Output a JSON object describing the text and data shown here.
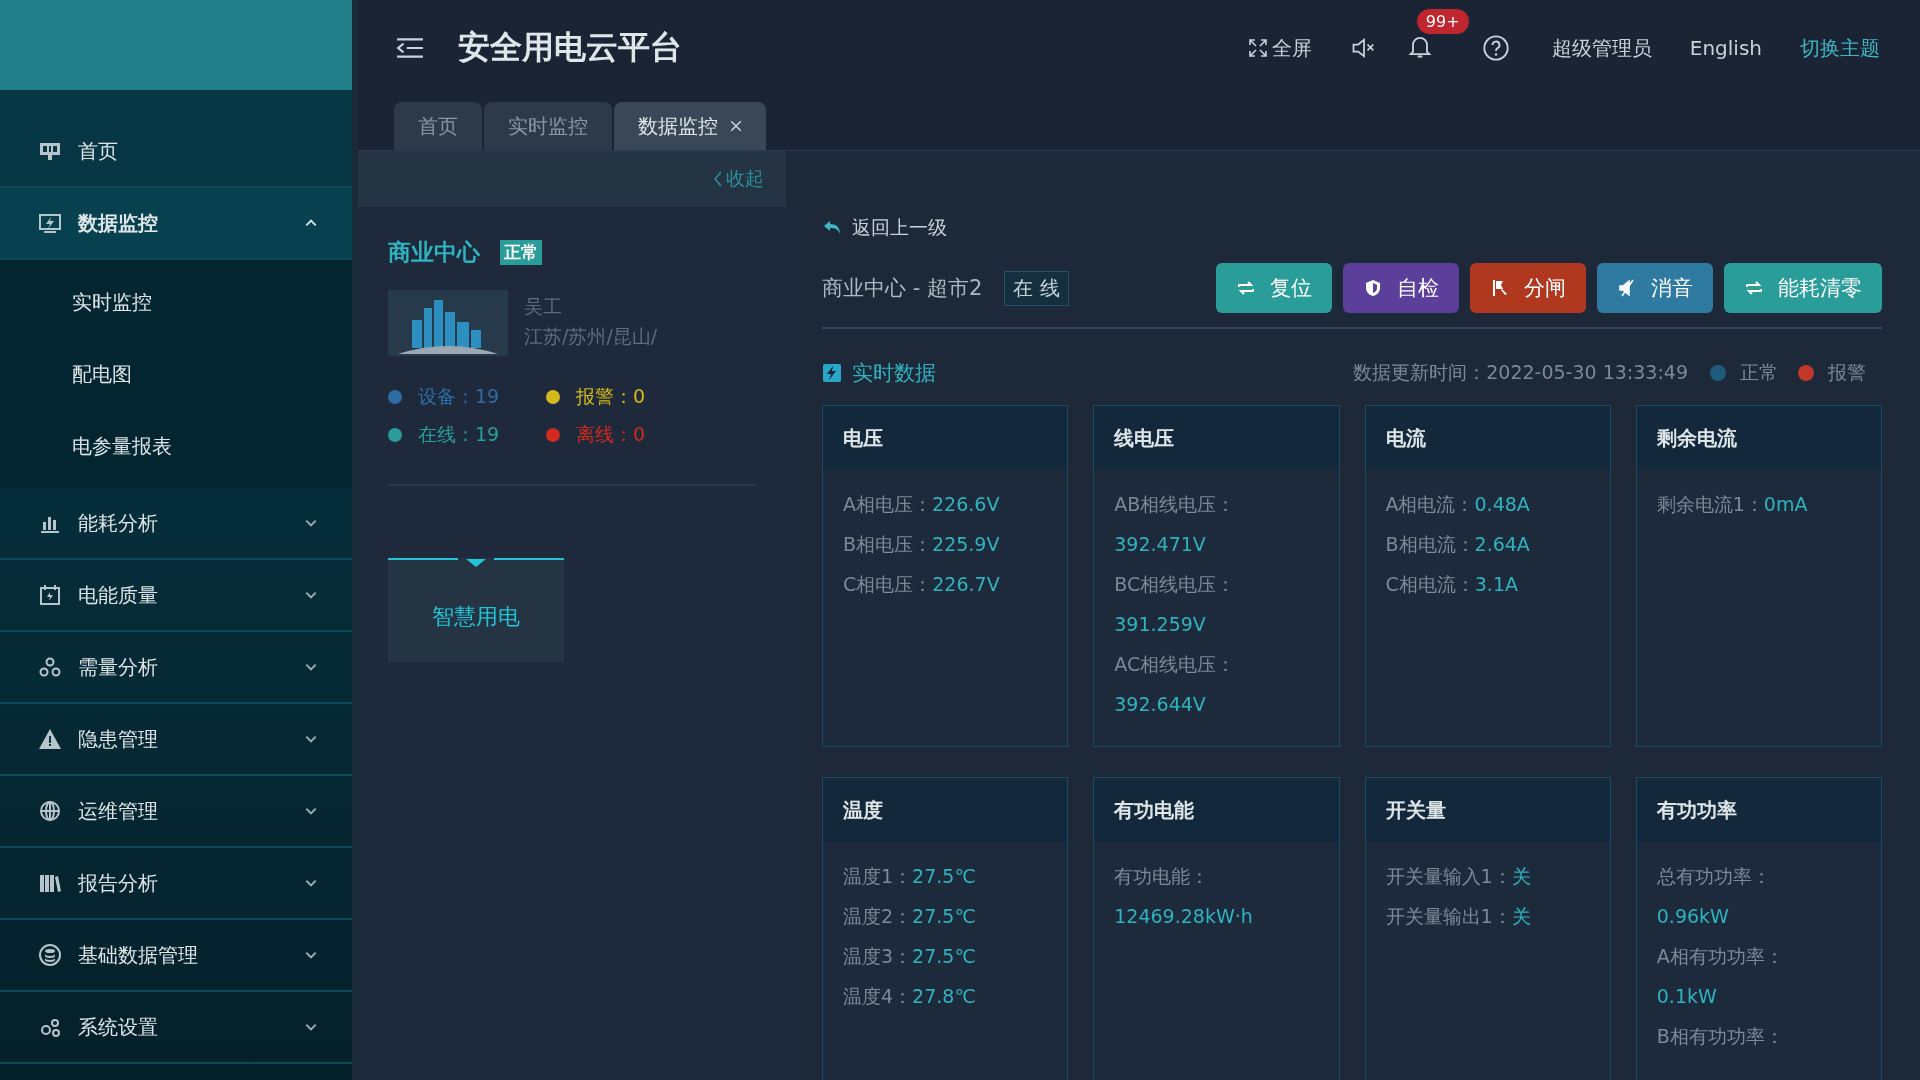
{
  "header": {
    "title": "安全用电云平台",
    "fullscreen": "全屏",
    "notifications_badge": "99+",
    "user": "超级管理员",
    "language": "English",
    "theme": "切换主题"
  },
  "sidebar": {
    "items": [
      {
        "label": "首页",
        "expanded": false,
        "has_children": false
      },
      {
        "label": "数据监控",
        "expanded": true,
        "has_children": true,
        "children": [
          {
            "label": "实时监控"
          },
          {
            "label": "配电图"
          },
          {
            "label": "电参量报表"
          }
        ]
      },
      {
        "label": "能耗分析",
        "expanded": false,
        "has_children": true
      },
      {
        "label": "电能质量",
        "expanded": false,
        "has_children": true
      },
      {
        "label": "需量分析",
        "expanded": false,
        "has_children": true
      },
      {
        "label": "隐患管理",
        "expanded": false,
        "has_children": true
      },
      {
        "label": "运维管理",
        "expanded": false,
        "has_children": true
      },
      {
        "label": "报告分析",
        "expanded": false,
        "has_children": true
      },
      {
        "label": "基础数据管理",
        "expanded": false,
        "has_children": true
      },
      {
        "label": "系统设置",
        "expanded": false,
        "has_children": true
      }
    ]
  },
  "tabs": [
    {
      "label": "首页",
      "selected": false,
      "closable": false
    },
    {
      "label": "实时监控",
      "selected": false,
      "closable": false
    },
    {
      "label": "数据监控",
      "selected": true,
      "closable": true
    }
  ],
  "site_panel": {
    "collapse": "收起",
    "name": "商业中心",
    "status": "正常",
    "contact": "吴工",
    "region": "江苏/苏州/昆山/",
    "stats": [
      {
        "label": "设备：",
        "value": "19",
        "color": "#2e6da4"
      },
      {
        "label": "报警：",
        "value": "0",
        "color": "#d4b81c"
      },
      {
        "label": "在线：",
        "value": "19",
        "color": "#2a9d9a"
      },
      {
        "label": "离线：",
        "value": "0",
        "color": "#d12a1f"
      }
    ],
    "category": "智慧用电"
  },
  "detail": {
    "back": "返回上一级",
    "device": "商业中心 - 超市2",
    "device_status": "在 线",
    "buttons": [
      {
        "label": "复位",
        "color": "#2a9d9a"
      },
      {
        "label": "自检",
        "color": "#5b3f9a"
      },
      {
        "label": "分闸",
        "color": "#b0381f"
      },
      {
        "label": "消音",
        "color": "#2f7aa0"
      },
      {
        "label": "能耗清零",
        "color": "#2a9d9a"
      }
    ],
    "section_title": "实时数据",
    "update_time": "数据更新时间：2022-05-30 13:33:49",
    "legend": [
      {
        "label": "正常",
        "color": "#1f5b7a"
      },
      {
        "label": "报警",
        "color": "#c0392b"
      }
    ],
    "cards": [
      {
        "title": "电压",
        "items": [
          {
            "label": "A相电压：",
            "value": "226.6V",
            "kind": "inline"
          },
          {
            "label": "B相电压：",
            "value": "225.9V",
            "kind": "inline"
          },
          {
            "label": "C相电压：",
            "value": "226.7V",
            "kind": "inline"
          }
        ]
      },
      {
        "title": "线电压",
        "items": [
          {
            "label": "AB相线电压：",
            "value": "392.471V",
            "kind": "stacked"
          },
          {
            "label": "BC相线电压：",
            "value": "391.259V",
            "kind": "stacked"
          },
          {
            "label": "AC相线电压：",
            "value": "392.644V",
            "kind": "stacked"
          }
        ]
      },
      {
        "title": "电流",
        "items": [
          {
            "label": "A相电流：",
            "value": "0.48A",
            "kind": "inline"
          },
          {
            "label": "B相电流：",
            "value": "2.64A",
            "kind": "inline"
          },
          {
            "label": "C相电流：",
            "value": "3.1A",
            "kind": "inline"
          }
        ]
      },
      {
        "title": "剩余电流",
        "items": [
          {
            "label": "剩余电流1：",
            "value": "0mA",
            "kind": "inline"
          }
        ]
      },
      {
        "title": "温度",
        "items": [
          {
            "label": "温度1：",
            "value": "27.5℃",
            "kind": "inline"
          },
          {
            "label": "温度2：",
            "value": "27.5℃",
            "kind": "inline"
          },
          {
            "label": "温度3：",
            "value": "27.5℃",
            "kind": "inline"
          },
          {
            "label": "温度4：",
            "value": "27.8℃",
            "kind": "inline"
          }
        ]
      },
      {
        "title": "有功电能",
        "items": [
          {
            "label": "有功电能：",
            "value": "12469.28kW·h",
            "kind": "stacked"
          }
        ]
      },
      {
        "title": "开关量",
        "items": [
          {
            "label": "开关量输入1：",
            "value": "关",
            "kind": "inline"
          },
          {
            "label": "开关量输出1：",
            "value": "关",
            "kind": "inline"
          }
        ]
      },
      {
        "title": "有功功率",
        "items": [
          {
            "label": "总有功功率：",
            "value": "0.96kW",
            "kind": "stacked"
          },
          {
            "label": "A相有功功率：",
            "value": "0.1kW",
            "kind": "stacked"
          },
          {
            "label": "B相有功功率：",
            "kind": "stacked"
          }
        ]
      }
    ]
  }
}
